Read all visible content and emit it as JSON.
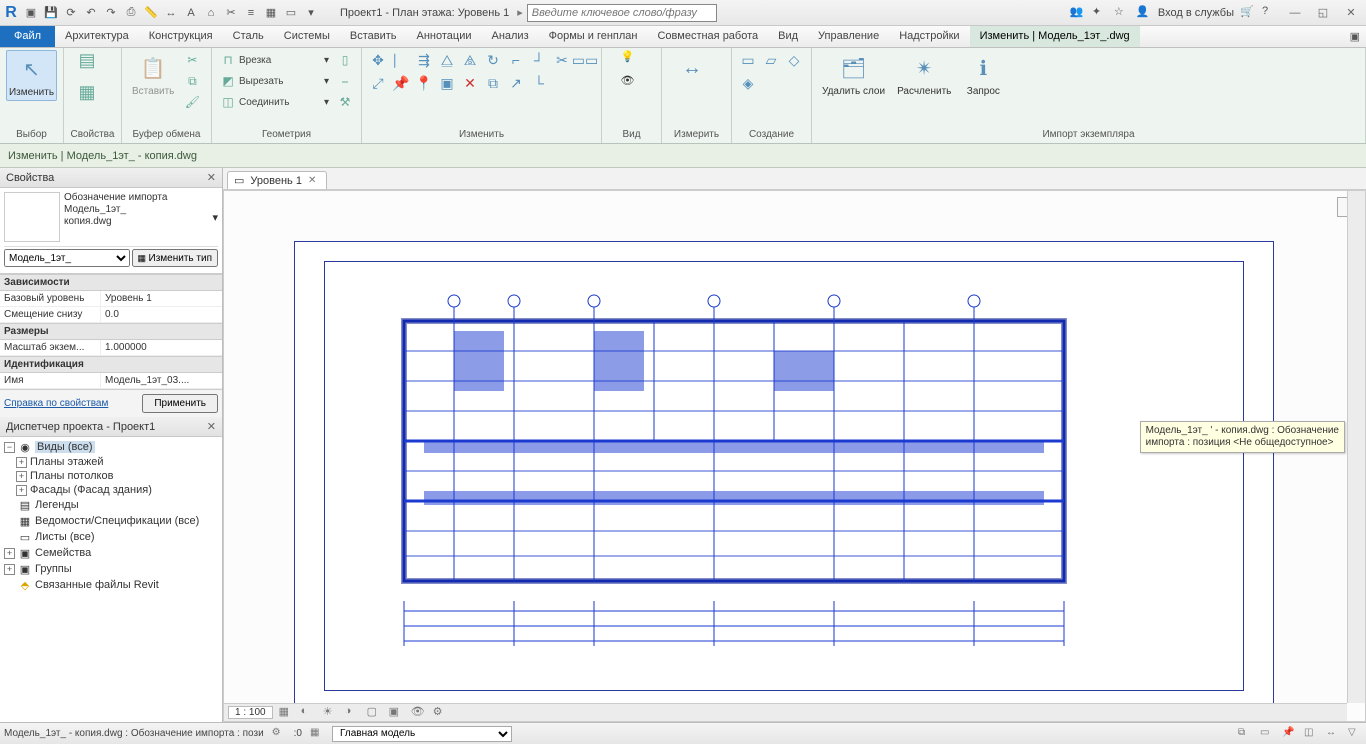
{
  "title": "Проект1 - План этажа: Уровень 1",
  "search_placeholder": "Введите ключевое слово/фразу",
  "signin": "Вход в службы",
  "menu": {
    "file": "Файл",
    "tabs": [
      "Архитектура",
      "Конструкция",
      "Сталь",
      "Системы",
      "Вставить",
      "Аннотации",
      "Анализ",
      "Формы и генплан",
      "Совместная работа",
      "Вид",
      "Управление",
      "Надстройки"
    ],
    "active": "Изменить | Модель_1эт_",
    "active_suffix": ".dwg"
  },
  "ribbon": {
    "select": {
      "modify": "Изменить",
      "label": "Выбор"
    },
    "props": {
      "label": "Свойства"
    },
    "clipboard": {
      "paste": "Вставить",
      "label": "Буфер обмена"
    },
    "geom": {
      "cut": "Врезка",
      "cutout": "Вырезать",
      "join": "Соединить",
      "label": "Геометрия"
    },
    "modify": {
      "label": "Изменить"
    },
    "view": {
      "label": "Вид"
    },
    "measure": {
      "label": "Измерить"
    },
    "create": {
      "label": "Создание"
    },
    "import": {
      "del": "Удалить слои",
      "explode": "Расчленить",
      "query": "Запрос",
      "label": "Импорт экземпляра"
    }
  },
  "context": "Изменить | Модель_1эт_             - копия.dwg",
  "props": {
    "title": "Свойства",
    "type_line1": "Обозначение импорта",
    "type_line2": "Модель_1эт_",
    "type_line3": "копия.dwg",
    "instance": "Модель_1эт_",
    "edit_type": "Изменить тип",
    "grp_dep": "Зависимости",
    "base_level_k": "Базовый уровень",
    "base_level_v": "Уровень 1",
    "offset_k": "Смещение снизу",
    "offset_v": "0.0",
    "grp_dim": "Размеры",
    "scale_k": "Масштаб экзем...",
    "scale_v": "1.000000",
    "grp_id": "Идентификация",
    "name_k": "Имя",
    "name_v": "Модель_1эт_03....",
    "help": "Справка по свойствам",
    "apply": "Применить"
  },
  "browser": {
    "title": "Диспетчер проекта - Проект1",
    "views": "Виды (все)",
    "floor": "Планы этажей",
    "ceil": "Планы потолков",
    "elev": "Фасады (Фасад здания)",
    "legends": "Легенды",
    "sched": "Ведомости/Спецификации (все)",
    "sheets": "Листы (все)",
    "fam": "Семейства",
    "groups": "Группы",
    "links": "Связанные файлы Revit"
  },
  "view": {
    "tab": "Уровень 1",
    "scale": "1 : 100"
  },
  "tooltip": {
    "l1": "Модель_1эт_             ' - копия.dwg : Обозначение",
    "l2": "импорта : позиция <Не общедоступное>"
  },
  "status": {
    "left": "Модель_1эт_             - копия.dwg : Обозначение импорта : пози",
    "zero": ":0",
    "model": "Главная модель"
  }
}
